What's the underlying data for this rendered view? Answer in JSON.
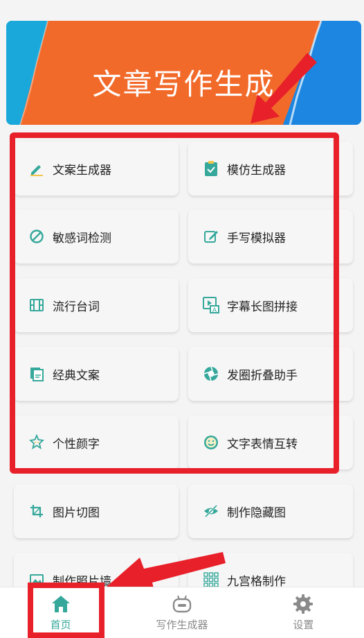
{
  "banner": {
    "title": "文章写作生成"
  },
  "tools": [
    {
      "label": "文案生成器",
      "icon": "pencil-icon"
    },
    {
      "label": "模仿生成器",
      "icon": "clipboard-check-icon"
    },
    {
      "label": "敏感词检测",
      "icon": "prohibit-icon"
    },
    {
      "label": "手写模拟器",
      "icon": "edit-square-icon"
    },
    {
      "label": "流行台词",
      "icon": "film-icon"
    },
    {
      "label": "字幕长图拼接",
      "icon": "subtitle-image-icon"
    },
    {
      "label": "经典文案",
      "icon": "document-stack-icon"
    },
    {
      "label": "发圈折叠助手",
      "icon": "camera-aperture-icon"
    },
    {
      "label": "个性颜字",
      "icon": "sparkle-face-icon"
    },
    {
      "label": "文字表情互转",
      "icon": "smiley-icon"
    },
    {
      "label": "图片切图",
      "icon": "crop-icon"
    },
    {
      "label": "制作隐藏图",
      "icon": "eye-off-icon"
    },
    {
      "label": "制作照片墙",
      "icon": "photo-wall-icon"
    },
    {
      "label": "九宫格制作",
      "icon": "nine-grid-icon"
    }
  ],
  "tabbar": {
    "home": "首页",
    "writer": "写作生成器",
    "settings": "设置"
  },
  "colors": {
    "accent": "#35a89b",
    "annotation": "#e8202a",
    "banner_orange": "#f26a2a",
    "banner_blue": "#1c86e0"
  }
}
